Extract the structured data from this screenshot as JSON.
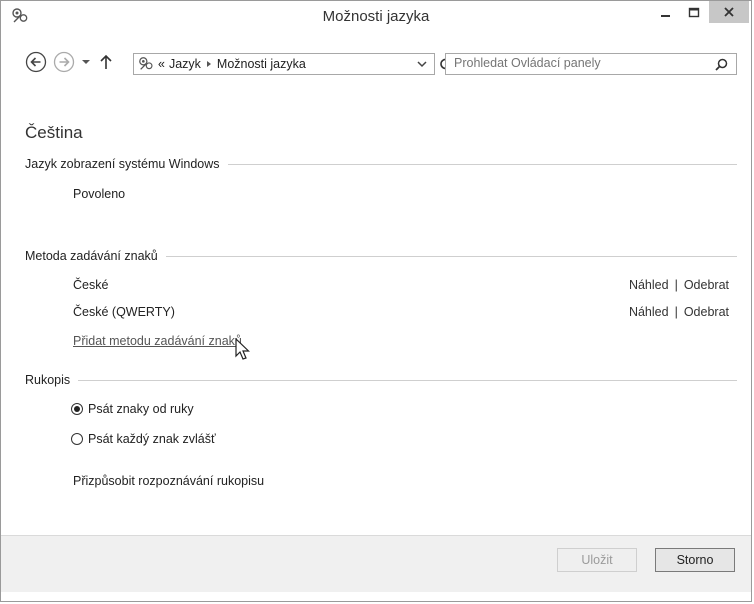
{
  "window": {
    "title": "Možnosti jazyka"
  },
  "nav": {
    "breadcrumb_prefix": "«",
    "breadcrumb": [
      "Jazyk",
      "Možnosti jazyka"
    ],
    "search_placeholder": "Prohledat Ovládací panely"
  },
  "main": {
    "language": "Čeština",
    "display_section": {
      "heading": "Jazyk zobrazení systému Windows",
      "status": "Povoleno"
    },
    "input_section": {
      "heading": "Metoda zadávání znaků",
      "methods": [
        {
          "name": "České",
          "preview": "Náhled",
          "separator": "|",
          "remove": "Odebrat"
        },
        {
          "name": "České (QWERTY)",
          "preview": "Náhled",
          "separator": "|",
          "remove": "Odebrat"
        }
      ],
      "add_link": "Přidat metodu zadávání znaků"
    },
    "handwriting_section": {
      "heading": "Rukopis",
      "options": [
        {
          "label": "Psát znaky od ruky",
          "selected": true
        },
        {
          "label": "Psát každý znak zvlášť",
          "selected": false
        }
      ],
      "personalize_label": "Přizpůsobit rozpoznávání rukopisu"
    }
  },
  "footer": {
    "save_label": "Uložit",
    "cancel_label": "Storno"
  }
}
